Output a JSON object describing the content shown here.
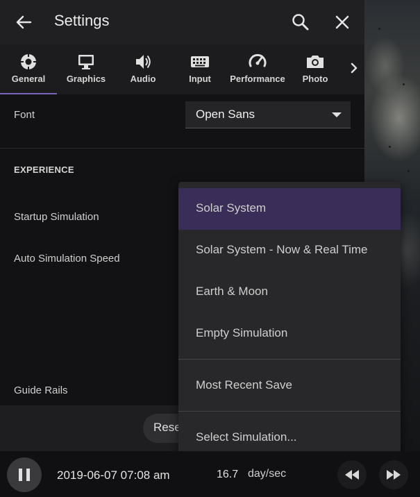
{
  "header": {
    "title": "Settings",
    "back_icon": "arrow-left-icon",
    "search_icon": "search-icon",
    "close_icon": "close-icon"
  },
  "tabs": [
    {
      "label": "General",
      "icon": "gear-icon",
      "active": true
    },
    {
      "label": "Graphics",
      "icon": "monitor-icon",
      "active": false
    },
    {
      "label": "Audio",
      "icon": "speaker-icon",
      "active": false
    },
    {
      "label": "Input",
      "icon": "keyboard-icon",
      "active": false
    },
    {
      "label": "Performance",
      "icon": "speedometer-icon",
      "active": false
    },
    {
      "label": "Photo",
      "icon": "camera-icon",
      "active": false
    }
  ],
  "font_setting": {
    "label": "Font",
    "value": "Open Sans"
  },
  "experience": {
    "heading": "EXPERIENCE",
    "startup_label": "Startup Simulation",
    "auto_speed_label": "Auto Simulation Speed",
    "guide_rails_label": "Guide Rails"
  },
  "reset_button": {
    "label": "Rese"
  },
  "dropdown": {
    "items": [
      {
        "label": "Solar System",
        "selected": true
      },
      {
        "label": "Solar System - Now & Real Time",
        "selected": false
      },
      {
        "label": "Earth & Moon",
        "selected": false
      },
      {
        "label": "Empty Simulation",
        "selected": false
      },
      {
        "label": "Most Recent Save",
        "selected": false
      },
      {
        "label": "Select Simulation...",
        "selected": false
      }
    ]
  },
  "timebar": {
    "datetime": "2019-06-07 07:08 am",
    "speed_value": "16.7",
    "speed_unit": "day/sec"
  },
  "colors": {
    "accent": "#7a64b8",
    "selected_bg": "#3a2d58",
    "panel_bg": "#121214",
    "header_bg": "#202022"
  }
}
